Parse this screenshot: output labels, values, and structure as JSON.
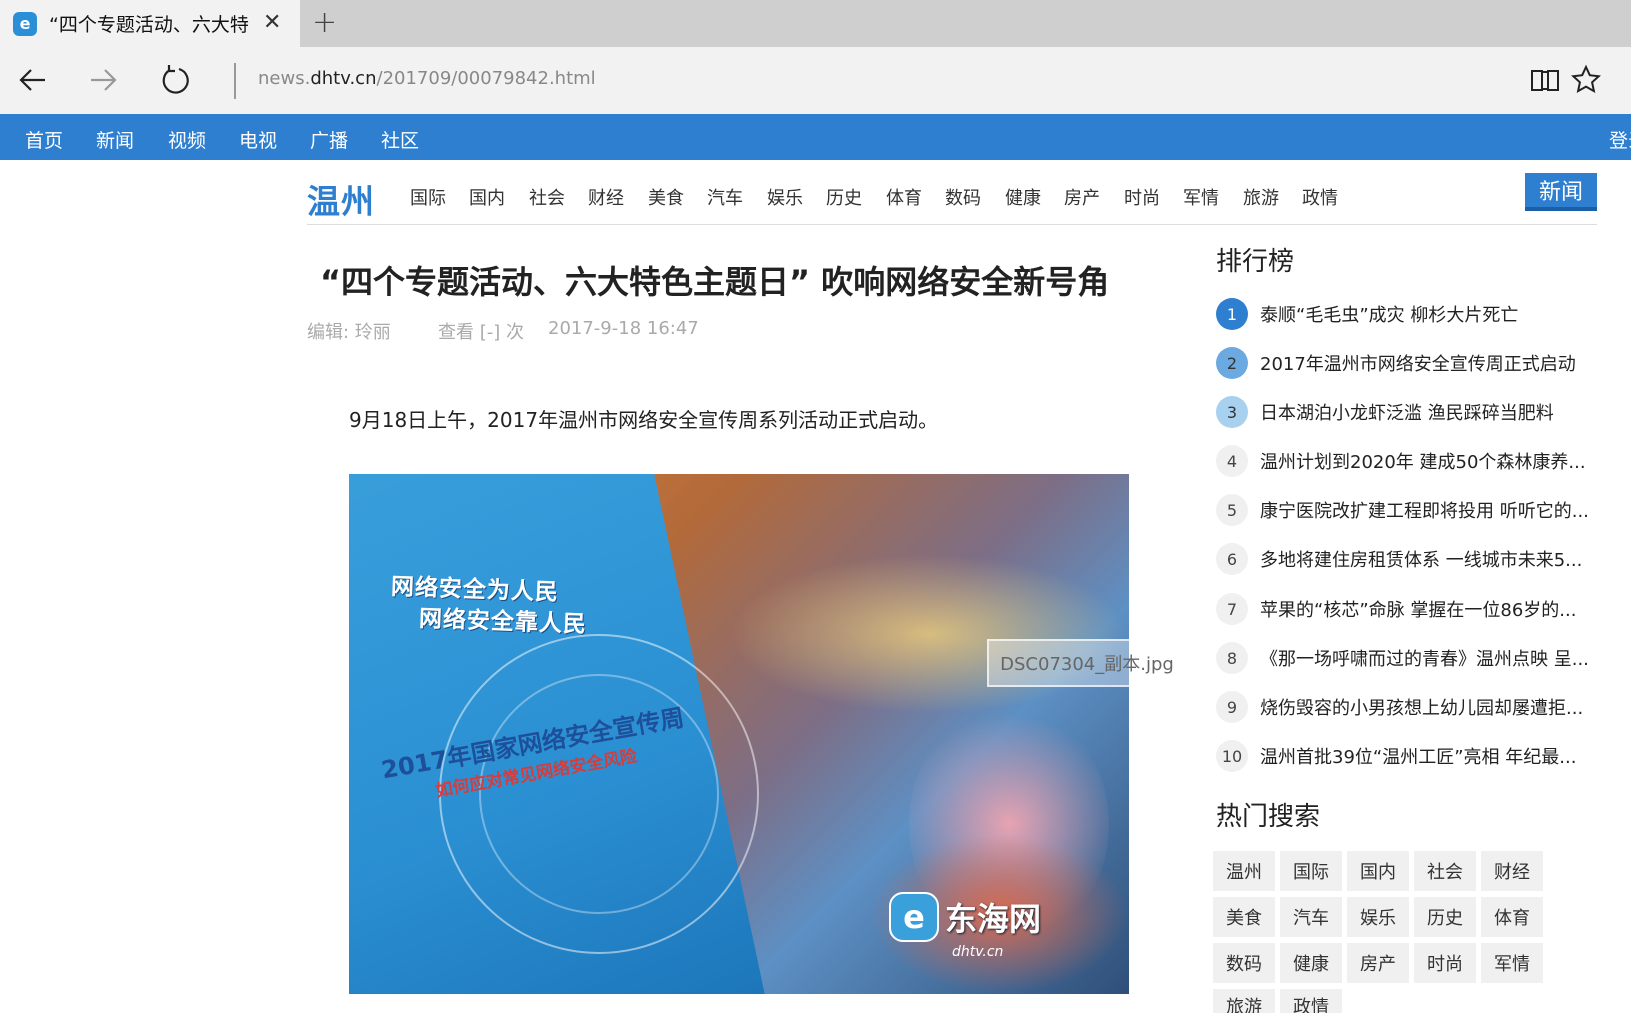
{
  "browser": {
    "tab_title": "“四个专题活动、六大特",
    "url_prefix": "news.",
    "url_domain": "dhtv.cn",
    "url_path": "/201709/00079842.html"
  },
  "site_nav": {
    "items": [
      "首页",
      "新闻",
      "视频",
      "电视",
      "广播",
      "社区"
    ],
    "login": "登录"
  },
  "channel": {
    "logo": "温州",
    "links": [
      "国际",
      "国内",
      "社会",
      "财经",
      "美食",
      "汽车",
      "娱乐",
      "历史",
      "体育",
      "数码",
      "健康",
      "房产",
      "时尚",
      "军情",
      "旅游",
      "政情"
    ],
    "badge": "新闻"
  },
  "article": {
    "title": "“四个专题活动、六大特色主题日” 吹响网络安全新号角",
    "editor": "编辑: 玲丽",
    "views": "查看 [-] 次",
    "date": "2017-9-18 16:47",
    "lead": "9月18日上午，2017年温州市网络安全宣传周系列活动正式启动。",
    "photo_label": "DSC07304_副本.jpg",
    "booklet_line1": "网络安全为人民",
    "booklet_line2": "网络安全靠人民",
    "booklet_title": "2017年国家网络安全宣传周",
    "booklet_sub": "如何应对常见网络安全风险",
    "watermark_name": "东海网",
    "watermark_domain": "dhtv.cn"
  },
  "ranking": {
    "heading": "排行榜",
    "items": [
      {
        "num": "1",
        "text": "泰顺“毛毛虫”成灾 柳杉大片死亡"
      },
      {
        "num": "2",
        "text": "2017年温州市网络安全宣传周正式启动"
      },
      {
        "num": "3",
        "text": "日本湖泊小龙虾泛滥 渔民踩碎当肥料"
      },
      {
        "num": "4",
        "text": "温州计划到2020年 建成50个森林康养..."
      },
      {
        "num": "5",
        "text": "康宁医院改扩建工程即将投用 听听它的..."
      },
      {
        "num": "6",
        "text": "多地将建住房租赁体系 一线城市未来5..."
      },
      {
        "num": "7",
        "text": "苹果的“核芯”命脉 掌握在一位86岁的..."
      },
      {
        "num": "8",
        "text": "《那一场呼啸而过的青春》温州点映 呈..."
      },
      {
        "num": "9",
        "text": "烧伤毁容的小男孩想上幼儿园却屡遭拒..."
      },
      {
        "num": "10",
        "text": "温州首批39位“温州工匠”亮相 年纪最..."
      }
    ]
  },
  "hot_search": {
    "heading": "热门搜索",
    "tags": [
      "温州",
      "国际",
      "国内",
      "社会",
      "财经",
      "美食",
      "汽车",
      "娱乐",
      "历史",
      "体育",
      "数码",
      "健康",
      "房产",
      "时尚",
      "军情",
      "旅游",
      "政情"
    ]
  }
}
